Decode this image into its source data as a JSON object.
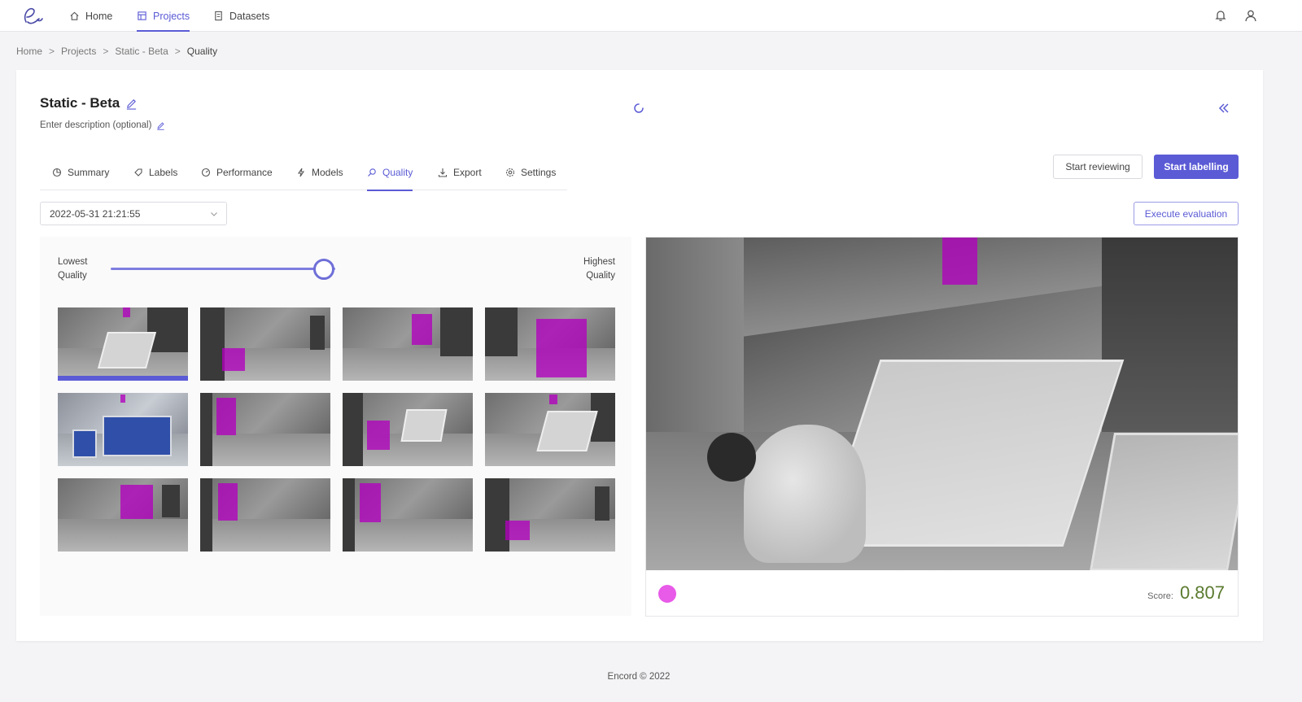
{
  "nav": {
    "items": [
      {
        "label": "Home",
        "icon": "home-icon"
      },
      {
        "label": "Projects",
        "icon": "projects-icon"
      },
      {
        "label": "Datasets",
        "icon": "datasets-icon"
      }
    ],
    "active": "Projects"
  },
  "breadcrumb": [
    "Home",
    "Projects",
    "Static - Beta",
    "Quality"
  ],
  "project": {
    "title": "Static - Beta",
    "description": "Enter description (optional)"
  },
  "tabs": [
    {
      "label": "Summary",
      "icon": "summary-icon"
    },
    {
      "label": "Labels",
      "icon": "labels-icon"
    },
    {
      "label": "Performance",
      "icon": "performance-icon"
    },
    {
      "label": "Models",
      "icon": "models-icon"
    },
    {
      "label": "Quality",
      "icon": "quality-icon"
    },
    {
      "label": "Export",
      "icon": "export-icon"
    },
    {
      "label": "Settings",
      "icon": "settings-icon"
    }
  ],
  "active_tab": "Quality",
  "buttons": {
    "start_reviewing": "Start reviewing",
    "start_labelling": "Start labelling",
    "execute_evaluation": "Execute evaluation"
  },
  "date_select": {
    "value": "2022-05-31 21:21:55"
  },
  "quality_slider": {
    "low_label_1": "Lowest",
    "low_label_2": "Quality",
    "high_label_1": "Highest",
    "high_label_2": "Quality",
    "value_fraction": 0.95
  },
  "thumbnails_count_selected_index": 0,
  "preview": {
    "score_label": "Score:",
    "score": "0.807",
    "label_color": "#e85ae8"
  },
  "colors": {
    "accent": "#5b5bd6",
    "box": "#b200be",
    "score": "#5a7a2e"
  },
  "footer": "Encord © 2022"
}
